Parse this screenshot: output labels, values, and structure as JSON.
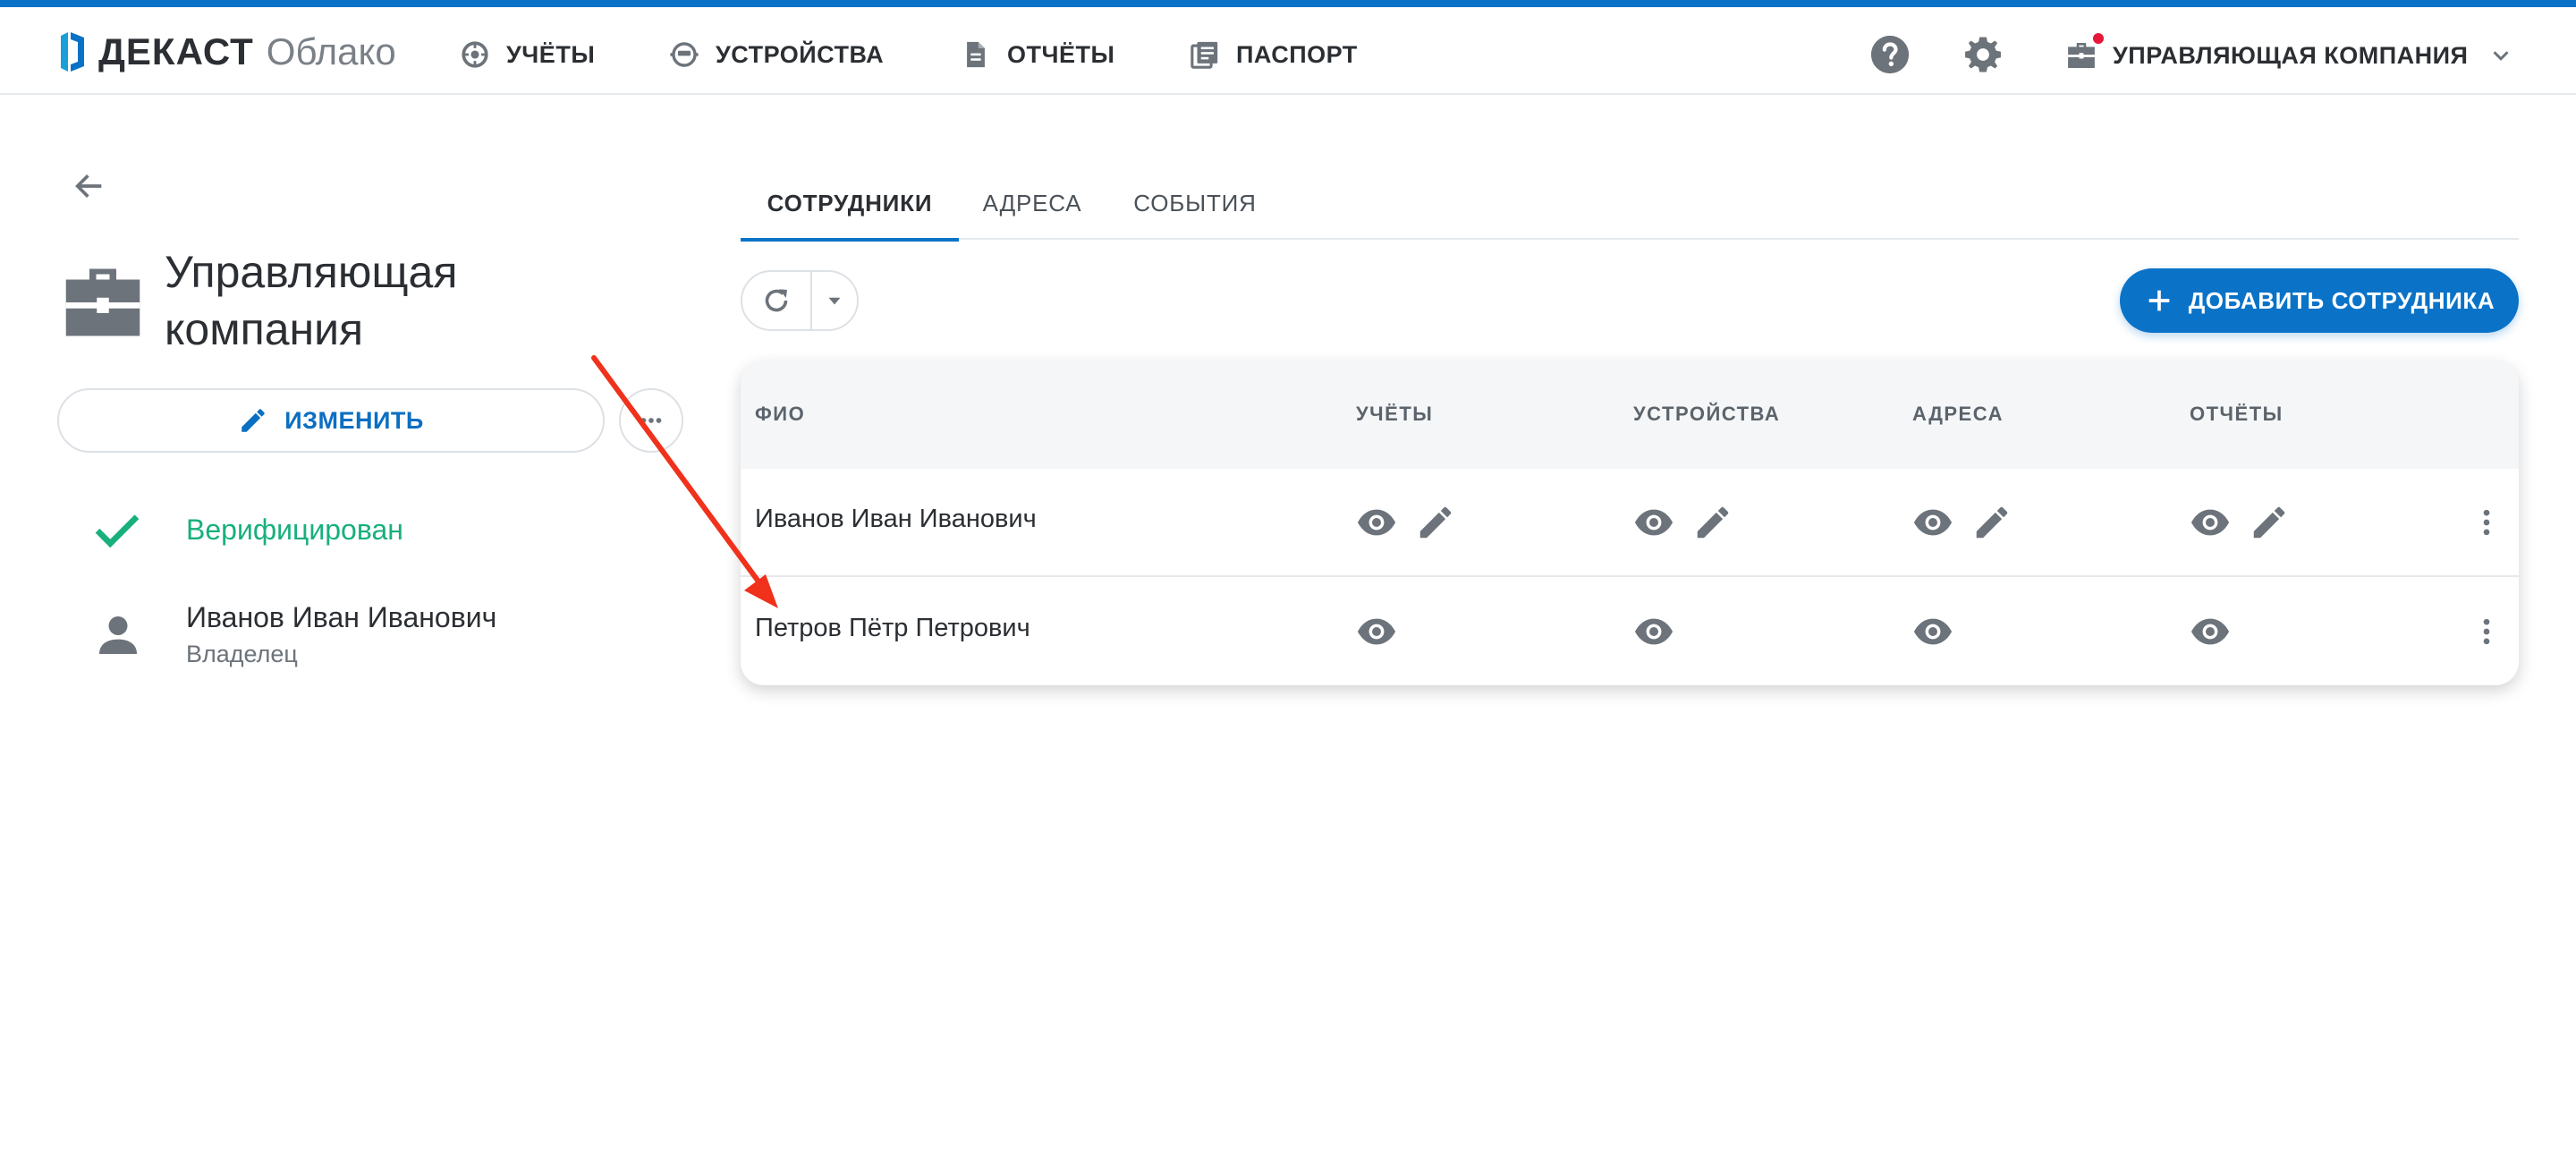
{
  "header": {
    "brand": "ДЕКАСТ",
    "product": "Облако",
    "nav": [
      {
        "label": "УЧЁТЫ",
        "icon": "gauge-icon"
      },
      {
        "label": "УСТРОЙСТВА",
        "icon": "meter-device-icon"
      },
      {
        "label": "ОТЧЁТЫ",
        "icon": "document-icon"
      },
      {
        "label": "ПАСПОРТ",
        "icon": "passport-icon"
      }
    ],
    "help_icon": "help-icon",
    "settings_icon": "gear-icon",
    "company_label": "УПРАВЛЯЮЩАЯ КОМПАНИЯ",
    "accent": "#0a73c8",
    "notify_color": "#e5183a"
  },
  "left_panel": {
    "title": "Управляющая компания",
    "edit_label": "ИЗМЕНИТЬ",
    "verified_label": "Верифицирован",
    "verified_color": "#18b07b",
    "owner_name": "Иванов Иван Иванович",
    "owner_role": "Владелец"
  },
  "tabs": [
    {
      "label": "СОТРУДНИКИ",
      "active": true
    },
    {
      "label": "АДРЕСА",
      "active": false
    },
    {
      "label": "СОБЫТИЯ",
      "active": false
    }
  ],
  "toolbar": {
    "add_label": "ДОБАВИТЬ СОТРУДНИКА"
  },
  "table": {
    "columns": [
      "ФИО",
      "УЧЁТЫ",
      "УСТРОЙСТВА",
      "АДРЕСА",
      "ОТЧЁТЫ"
    ],
    "rows": [
      {
        "name": "Иванов Иван Иванович",
        "permissions": [
          "view-edit",
          "view-edit",
          "view-edit",
          "view-edit"
        ]
      },
      {
        "name": "Петров Пётр Петрович",
        "permissions": [
          "view",
          "view",
          "view",
          "view"
        ]
      }
    ]
  },
  "annotation": {
    "type": "arrow",
    "color": "#f0311c"
  }
}
